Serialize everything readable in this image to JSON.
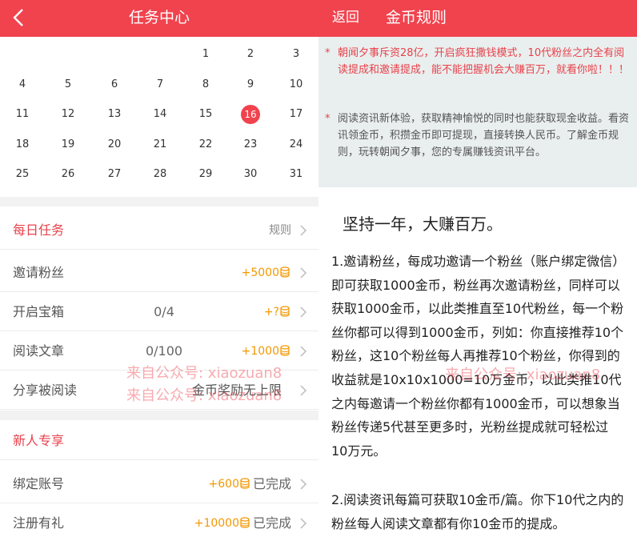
{
  "left": {
    "title": "任务中心",
    "calendar": {
      "rows": [
        [
          "",
          "",
          "",
          "",
          "1",
          "2",
          "3"
        ],
        [
          "4",
          "5",
          "6",
          "7",
          "8",
          "9",
          "10"
        ],
        [
          "11",
          "12",
          "13",
          "14",
          "15",
          "16",
          "17"
        ],
        [
          "18",
          "19",
          "20",
          "21",
          "22",
          "23",
          "24"
        ],
        [
          "25",
          "26",
          "27",
          "28",
          "29",
          "30",
          "31"
        ]
      ],
      "today": "16"
    },
    "daily": {
      "title": "每日任务",
      "rule_label": "规则",
      "tasks": [
        {
          "name": "邀请粉丝",
          "progress": "",
          "reward": "+5000"
        },
        {
          "name": "开启宝箱",
          "progress": "0/4",
          "reward": "+?"
        },
        {
          "name": "阅读文章",
          "progress": "0/100",
          "reward": "+1000"
        },
        {
          "name": "分享被阅读",
          "progress": "",
          "reward": "",
          "note": "金币奖励无上限"
        }
      ]
    },
    "newbie": {
      "title": "新人专享",
      "tasks": [
        {
          "name": "绑定账号",
          "reward": "+600",
          "status": "已完成"
        },
        {
          "name": "注册有礼",
          "reward": "+10000",
          "status": "已完成"
        }
      ]
    },
    "watermark": "来自公众号: xiaozuan8"
  },
  "right": {
    "back_label": "返回",
    "title": "金币规则",
    "notices": [
      {
        "star": "*",
        "text": "朝闻夕事斥资28亿，开启疯狂撒钱模式，10代粉丝之内全有阅读提成和邀请提成，能不能把握机会大赚百万，就看你啦！！！"
      },
      {
        "star": "*",
        "text": "阅读资讯新体验，获取精神愉悦的同时也能获取现金收益。看资讯领金币，积攒金币即可提现，直接转换人民币。了解金币规则，玩转朝闻夕事，您的专属赚钱资讯平台。"
      }
    ],
    "article_title": "坚持一年，大赚百万。",
    "paragraphs": [
      "1.邀请粉丝，每成功邀请一个粉丝（账户绑定微信）即可获取1000金币，粉丝再次邀请粉丝，同样可以获取1000金币，以此类推直至10代粉丝，每一个粉丝你都可以得到1000金币，列如：你直接推荐10个粉丝，这10个粉丝每人再推荐10个粉丝，你得到的收益就是10x10x1000=10万金币，以此类推10代之内每邀请一个粉丝你都有1000金币，可以想象当粉丝传递5代甚至更多时，光粉丝提成就可轻松过10万元。",
      "2.阅读资讯每篇可获取10金币/篇。你下10代之内的粉丝每人阅读文章都有你10金币的提成。"
    ],
    "watermark": "来自公众号: xiaozuan8"
  },
  "colors": {
    "brand_red": "#f0434e",
    "reward_orange": "#f39700",
    "notice_bg": "#e9efee"
  },
  "icons": [
    "back-arrow-icon",
    "chevron-right-icon",
    "coin-stack-icon"
  ]
}
